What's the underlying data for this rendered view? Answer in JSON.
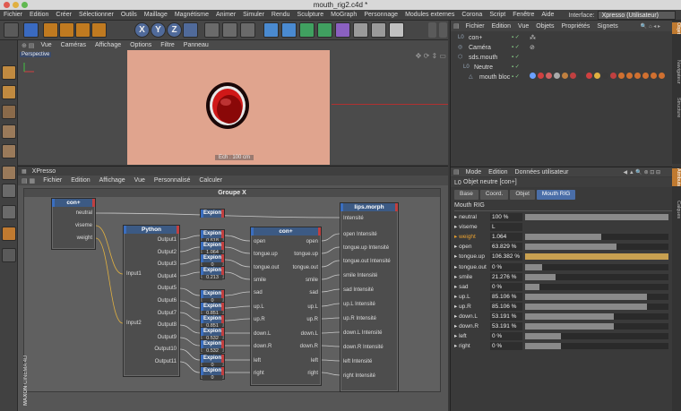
{
  "window": {
    "title": "mouth_rig2.c4d *"
  },
  "menubar": [
    "Fichier",
    "Edition",
    "Créer",
    "Sélectionner",
    "Outils",
    "Maillage",
    "Magnétisme",
    "Animer",
    "Simuler",
    "Rendu",
    "Sculpture",
    "MoGraph",
    "Personnage",
    "Modules externes",
    "Corona",
    "Script",
    "Fenêtre",
    "Aide"
  ],
  "interface": {
    "label": "Interface:",
    "value": "Xpresso (Utilisateur)"
  },
  "toolbar_icons": [
    "undo-icon",
    "select-live-icon",
    "move-icon",
    "scale-icon",
    "rotate-icon",
    "recent-tool-icon",
    "x-axis-icon",
    "y-axis-icon",
    "z-axis-icon",
    "coordinate-system-icon",
    "render-view-icon",
    "render-picture-viewer-icon",
    "render-settings-icon",
    "cube-icon",
    "spline-pen-icon",
    "subdivision-icon",
    "array-icon",
    "deformer-icon",
    "scene-icon",
    "camera-icon",
    "light-icon"
  ],
  "viewport": {
    "menu": [
      "Vue",
      "Caméras",
      "Affichage",
      "Options",
      "Filtre",
      "Panneau"
    ],
    "label": "Perspective",
    "scale_readout": "Ech : 100 cm"
  },
  "xpresso": {
    "title": "XPresso",
    "menu": [
      "Fichier",
      "Edition",
      "Affichage",
      "Vue",
      "Personnalisé",
      "Calculer"
    ],
    "group_title": "Groupe X",
    "nodes": {
      "con_left": {
        "title": "con+",
        "ports": [
          "neutral",
          "viseme",
          "weight"
        ]
      },
      "python": {
        "title": "Python",
        "inputs": [
          "Input1",
          "Input2"
        ],
        "outputs": [
          "Output1",
          "Output2",
          "Output3",
          "Output4",
          "Output5",
          "Output6",
          "Output7",
          "Output8",
          "Output9",
          "Output10",
          "Output11"
        ]
      },
      "con_mid": {
        "title": "con+",
        "in_ports": [
          "open",
          "tongue.up",
          "tongue.out",
          "smile",
          "sad",
          "up.L",
          "up.R",
          "down.L",
          "down.R",
          "left",
          "right"
        ],
        "out_ports": [
          "open",
          "tongue.up",
          "tongue.out",
          "smile",
          "sad",
          "up.L",
          "up.R",
          "down.L",
          "down.R",
          "left",
          "right"
        ]
      },
      "lips": {
        "title": "lips.morph",
        "ports": [
          "Intensité",
          "open Intensité",
          "tongue.up Intensité",
          "tongue.out Intensité",
          "smile Intensité",
          "sad Intensité",
          "up.L Intensité",
          "up.R Intensité",
          "down.L Intensité",
          "down.R Intensité",
          "left Intensité",
          "right Intensité"
        ]
      },
      "expnodes": [
        {
          "title": "Expion",
          "value": ""
        },
        {
          "title": "Expion",
          "value": "0.618"
        },
        {
          "title": "Expion",
          "value": "1.064"
        },
        {
          "title": "Expion",
          "value": "0"
        },
        {
          "title": "Expion",
          "value": "0.213"
        },
        {
          "title": "Expion",
          "value": "0"
        },
        {
          "title": "Expion",
          "value": "0.851"
        },
        {
          "title": "Expion",
          "value": "0.851"
        },
        {
          "title": "Expion",
          "value": "0.532"
        },
        {
          "title": "Expion",
          "value": "0.532"
        },
        {
          "title": "Expion",
          "value": "0"
        },
        {
          "title": "Expion",
          "value": "0"
        }
      ]
    }
  },
  "objects": {
    "menu": [
      "Fichier",
      "Edition",
      "Vue",
      "Objets",
      "Propriétés",
      "Signets"
    ],
    "items": [
      {
        "name": "con+",
        "indent": 0
      },
      {
        "name": "Caméra",
        "indent": 0
      },
      {
        "name": "sds.mouth",
        "indent": 0
      },
      {
        "name": "Neutre",
        "indent": 1
      },
      {
        "name": "mouth bloc",
        "indent": 2
      }
    ],
    "side_tabs": [
      "Objet",
      "Navigateur",
      "Structure"
    ]
  },
  "attributes": {
    "menu": [
      "Mode",
      "Edition",
      "Données utilisateur"
    ],
    "header": "Objet neutre [con+]",
    "tabs": [
      "Base",
      "Coord.",
      "Objet",
      "Mouth RIG"
    ],
    "active_tab": "Mouth RIG",
    "section": "Mouth RIG",
    "side_tabs": [
      "Attributs",
      "Calques"
    ],
    "params": [
      {
        "name": "neutral",
        "value": "100 %",
        "fraction": 1.0,
        "color": "grey"
      },
      {
        "name": "viseme",
        "value": "L",
        "fraction": 0,
        "color": "none"
      },
      {
        "name": "weight",
        "value": "1.064",
        "fraction": 0.53,
        "color": "grey",
        "highlight": "#e8a030"
      },
      {
        "name": "open",
        "value": "63.829 %",
        "fraction": 0.638,
        "color": "grey"
      },
      {
        "name": "tongue.up",
        "value": "106.382 %",
        "fraction": 1.0,
        "color": "orange"
      },
      {
        "name": "tongue.out",
        "value": "0 %",
        "fraction": 0.12,
        "color": "grey"
      },
      {
        "name": "smile",
        "value": "21.276 %",
        "fraction": 0.213,
        "color": "grey"
      },
      {
        "name": "sad",
        "value": "0 %",
        "fraction": 0.1,
        "color": "grey"
      },
      {
        "name": "up.L",
        "value": "85.106 %",
        "fraction": 0.851,
        "color": "grey"
      },
      {
        "name": "up.R",
        "value": "85.106 %",
        "fraction": 0.851,
        "color": "grey"
      },
      {
        "name": "down.L",
        "value": "53.191 %",
        "fraction": 0.62,
        "color": "grey"
      },
      {
        "name": "down.R",
        "value": "53.191 %",
        "fraction": 0.62,
        "color": "grey"
      },
      {
        "name": "left",
        "value": "0 %",
        "fraction": 0.25,
        "color": "grey"
      },
      {
        "name": "right",
        "value": "0 %",
        "fraction": 0.25,
        "color": "grey"
      }
    ]
  },
  "brand": {
    "line1": "MAXON",
    "line2": "CINEMA 4D"
  }
}
